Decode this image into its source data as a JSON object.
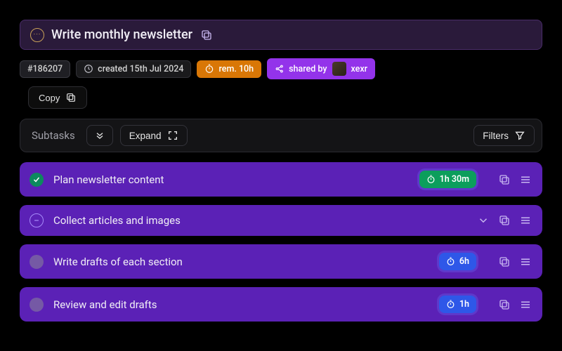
{
  "task": {
    "title": "Write monthly newsletter",
    "id": "#186207",
    "created_label": "created 15th Jul 2024",
    "remaining_label": "rem. 10h",
    "shared_label": "shared by",
    "shared_user": "xexr"
  },
  "buttons": {
    "copy": "Copy",
    "expand": "Expand",
    "filters": "Filters"
  },
  "subtasks_header": "Subtasks",
  "subtasks": [
    {
      "title": "Plan newsletter content",
      "status": "done",
      "time": "1h 30m",
      "time_color": "green",
      "chevron": false
    },
    {
      "title": "Collect articles and images",
      "status": "open",
      "time": null,
      "time_color": null,
      "chevron": true
    },
    {
      "title": "Write drafts of each section",
      "status": "empty",
      "time": "6h",
      "time_color": "blue",
      "chevron": false
    },
    {
      "title": "Review and edit drafts",
      "status": "empty",
      "time": "1h",
      "time_color": "blue",
      "chevron": false
    }
  ]
}
